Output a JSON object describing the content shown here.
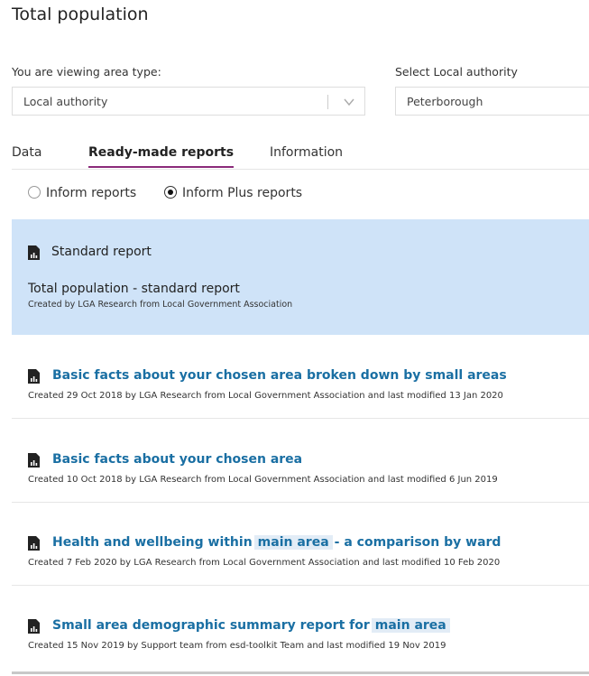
{
  "page": {
    "title": "Total population"
  },
  "filters": {
    "area_type_label": "You are viewing area type:",
    "area_type_value": "Local authority",
    "la_label": "Select Local authority",
    "la_value": "Peterborough"
  },
  "tabs": [
    {
      "label": "Data",
      "active": false
    },
    {
      "label": "Ready-made reports",
      "active": true
    },
    {
      "label": "Information",
      "active": false
    }
  ],
  "report_types": [
    {
      "label": "Inform reports",
      "selected": false
    },
    {
      "label": "Inform Plus reports",
      "selected": true
    }
  ],
  "selected_card": {
    "label": "Standard report",
    "title": "Total population - standard report",
    "meta": "Created by LGA Research from Local Government Association"
  },
  "reports": [
    {
      "title_before": "Basic facts about your chosen area broken down by small areas",
      "highlight": "",
      "title_after": "",
      "meta": "Created 29 Oct 2018 by LGA Research from Local Government Association and last modified 13 Jan 2020"
    },
    {
      "title_before": "Basic facts about your chosen area",
      "highlight": "",
      "title_after": "",
      "meta": "Created 10 Oct 2018 by LGA Research from Local Government Association and last modified 6 Jun 2019"
    },
    {
      "title_before": "Health and wellbeing within",
      "highlight": "main area",
      "title_after": "- a comparison by ward",
      "meta": "Created 7 Feb 2020 by LGA Research from Local Government Association and last modified 10 Feb 2020"
    },
    {
      "title_before": "Small area demographic summary report for",
      "highlight": "main area",
      "title_after": "",
      "meta": "Created 15 Nov 2019 by Support team from esd-toolkit Team and last modified 19 Nov 2019"
    }
  ],
  "colors": {
    "accent_tab": "#8b2a7a",
    "link": "#1a6fa3",
    "selected_card_bg": "#cfe3f8"
  }
}
